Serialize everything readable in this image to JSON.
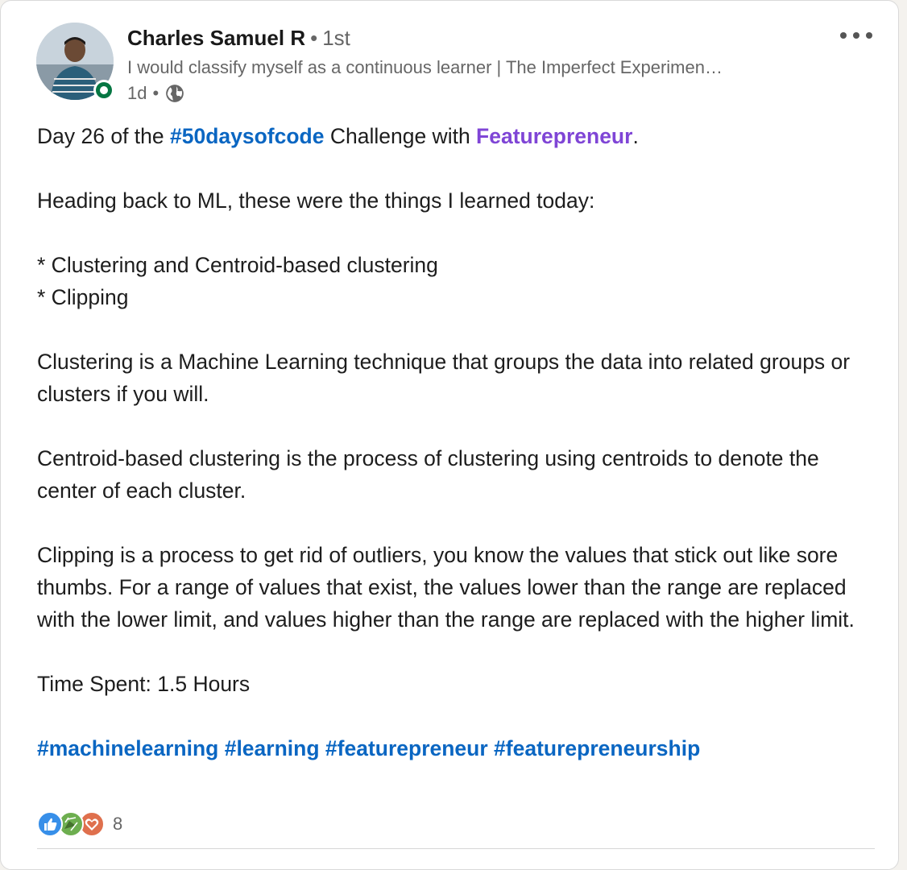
{
  "author": {
    "name": "Charles Samuel R",
    "degree_separator": "•",
    "degree": "1st",
    "headline": "I would classify myself as a continuous learner | The Imperfect Experimen…",
    "time": "1d",
    "time_separator": "•",
    "visibility_icon": "globe-icon",
    "presence_color": "#057642"
  },
  "post": {
    "line1_prefix": "Day 26 of the ",
    "line1_hashtag": "#50daysofcode",
    "line1_middle": " Challenge with ",
    "line1_mention": "Featurepreneur",
    "line1_suffix": ".",
    "intro": "Heading back to ML, these were the things I learned today:",
    "bullets": [
      "* Clustering and Centroid-based clustering",
      "* Clipping"
    ],
    "para_clustering": "Clustering is a Machine Learning technique that groups the data into related groups or clusters if you will.",
    "para_centroid": "Centroid-based clustering is the process of clustering using centroids to denote the center of each cluster.",
    "para_clipping": "Clipping is a process to get rid of outliers, you know the values that stick out like sore thumbs. For a range of values that exist, the values lower than the range are replaced with the lower limit, and values higher than the range are replaced with the higher limit.",
    "time_spent": "Time Spent: 1.5 Hours",
    "hashtags": [
      "#machinelearning",
      "#learning",
      "#featurepreneur",
      "#featurepreneurship"
    ]
  },
  "reactions": {
    "icons": [
      "like-icon",
      "celebrate-icon",
      "love-icon"
    ],
    "count": "8"
  },
  "colors": {
    "link": "#0a66c2",
    "mention": "#7f45d6",
    "like": "#378fe9",
    "celebrate": "#44712e",
    "love": "#df704d"
  }
}
